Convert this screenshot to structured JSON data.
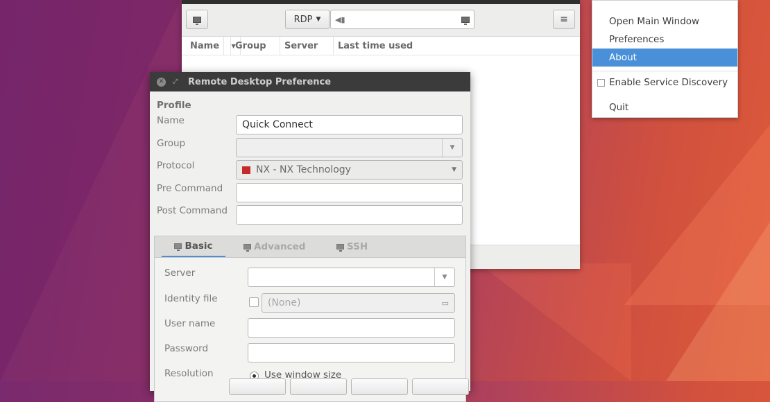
{
  "main_window": {
    "protocol": "RDP",
    "columns": [
      "Name",
      "Group",
      "Server",
      "Last time used"
    ]
  },
  "tray_menu": {
    "items": [
      "Open Main Window",
      "Preferences",
      "About",
      "Enable Service Discovery",
      "Quit"
    ],
    "selected": "About"
  },
  "dialog": {
    "title": "Remote Desktop Preference",
    "section": "Profile",
    "labels": {
      "name": "Name",
      "group": "Group",
      "protocol": "Protocol",
      "pre_command": "Pre Command",
      "post_command": "Post Command"
    },
    "values": {
      "name": "Quick Connect",
      "group": "",
      "protocol": "NX - NX Technology",
      "pre_command": "",
      "post_command": ""
    },
    "tabs": [
      "Basic",
      "Advanced",
      "SSH"
    ],
    "active_tab": "Basic",
    "basic": {
      "server_label": "Server",
      "identity_label": "Identity file",
      "identity_value": "(None)",
      "username_label": "User name",
      "password_label": "Password",
      "resolution_label": "Resolution",
      "resolution_option": "Use window size"
    }
  },
  "colors": {
    "selection": "#4a90d9",
    "titlebar": "#3b3b3b",
    "nx_icon": "#c72a2a"
  },
  "icons": [
    "monitor-icon",
    "dropdown-arrow-icon",
    "hamburger-menu-icon",
    "close-icon",
    "maximize-icon",
    "file-icon",
    "radio-icon",
    "checkbox-icon"
  ]
}
